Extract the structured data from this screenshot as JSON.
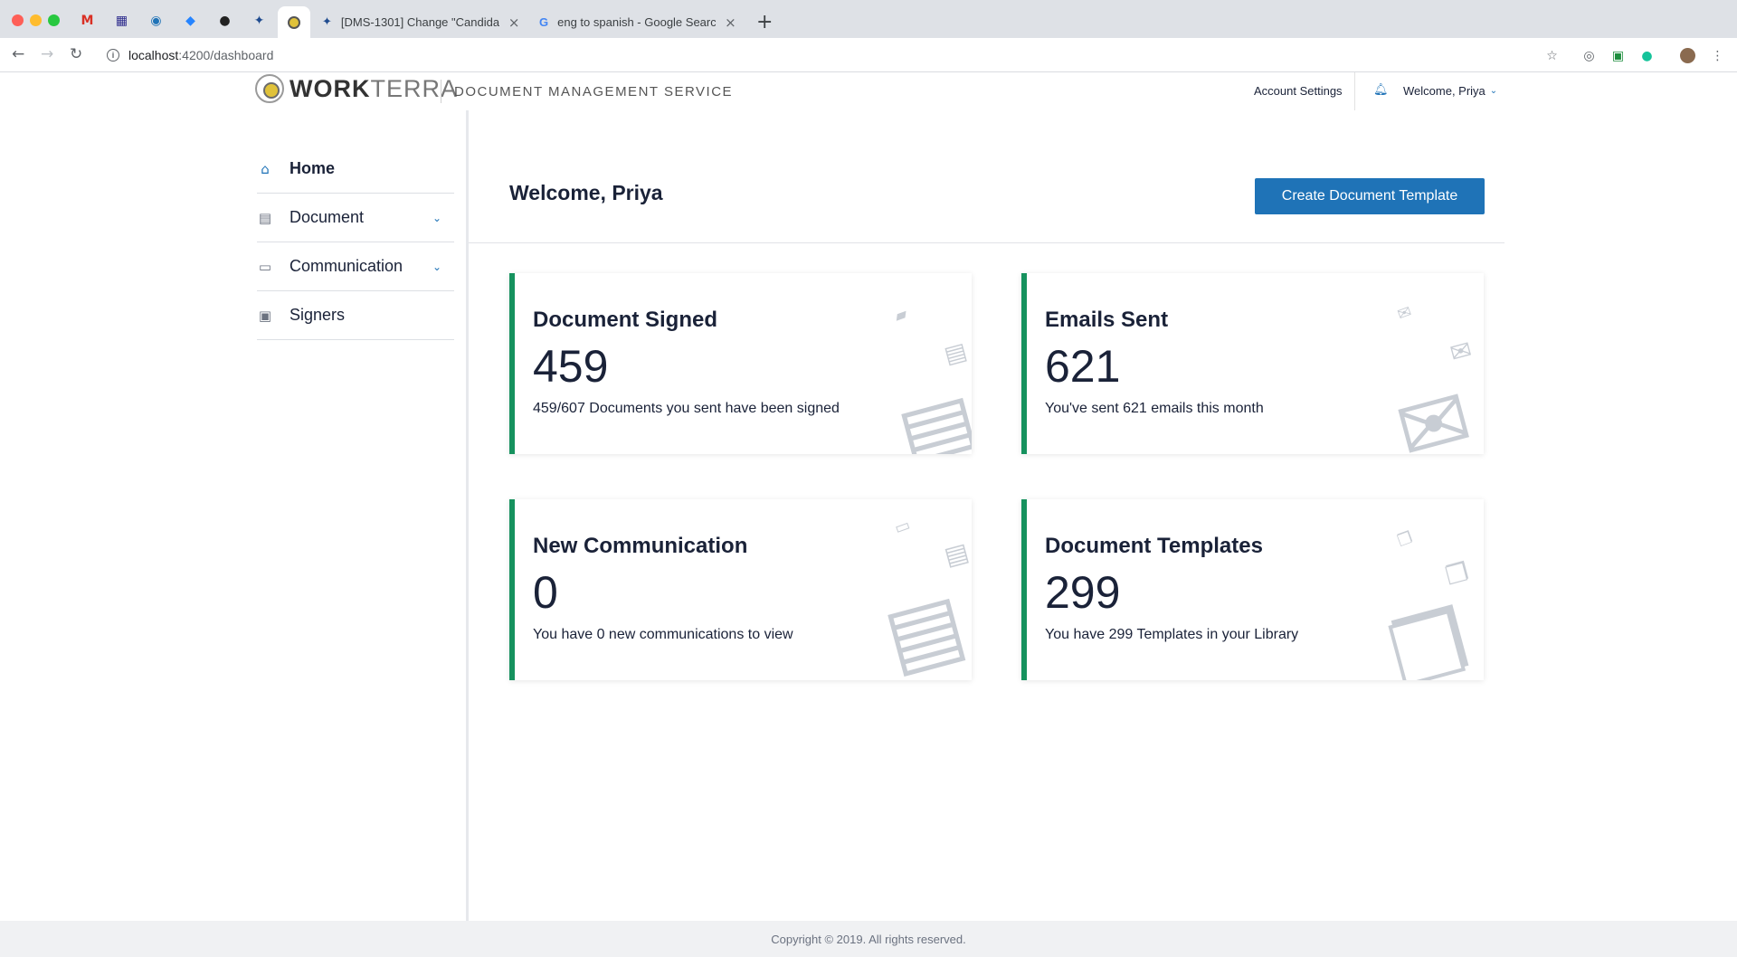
{
  "browser": {
    "tabs": [
      {
        "title": "[DMS-1301] Change \"Candidat",
        "close": "×"
      },
      {
        "title": "eng to spanish - Google Searc",
        "close": "×"
      }
    ],
    "new_tab": "+",
    "url_host": "localhost",
    "url_path": ":4200/dashboard",
    "info": "i"
  },
  "header": {
    "logo_bold": "WORK",
    "logo_light": "TERRA",
    "service_title": "DOCUMENT MANAGEMENT SERVICE",
    "account_settings": "Account Settings",
    "welcome": "Welcome, Priya"
  },
  "sidebar": {
    "items": [
      {
        "label": "Home"
      },
      {
        "label": "Document"
      },
      {
        "label": "Communication"
      },
      {
        "label": "Signers"
      }
    ]
  },
  "main": {
    "title": "Welcome, Priya",
    "create_button": "Create Document Template",
    "cards": [
      {
        "title": "Document Signed",
        "value": "459",
        "desc": "459/607 Documents you sent have been signed"
      },
      {
        "title": "Emails Sent",
        "value": "621",
        "desc": "You've sent 621 emails this month"
      },
      {
        "title": "New Communication",
        "value": "0",
        "desc": "You have 0 new communications to view"
      },
      {
        "title": "Document Templates",
        "value": "299",
        "desc": "You have 299 Templates in your Library"
      }
    ]
  },
  "footer": {
    "copyright": "Copyright © 2019. All rights reserved."
  },
  "colors": {
    "accent": "#1f73b7",
    "card_border": "#16925e",
    "text": "#1a2238"
  }
}
